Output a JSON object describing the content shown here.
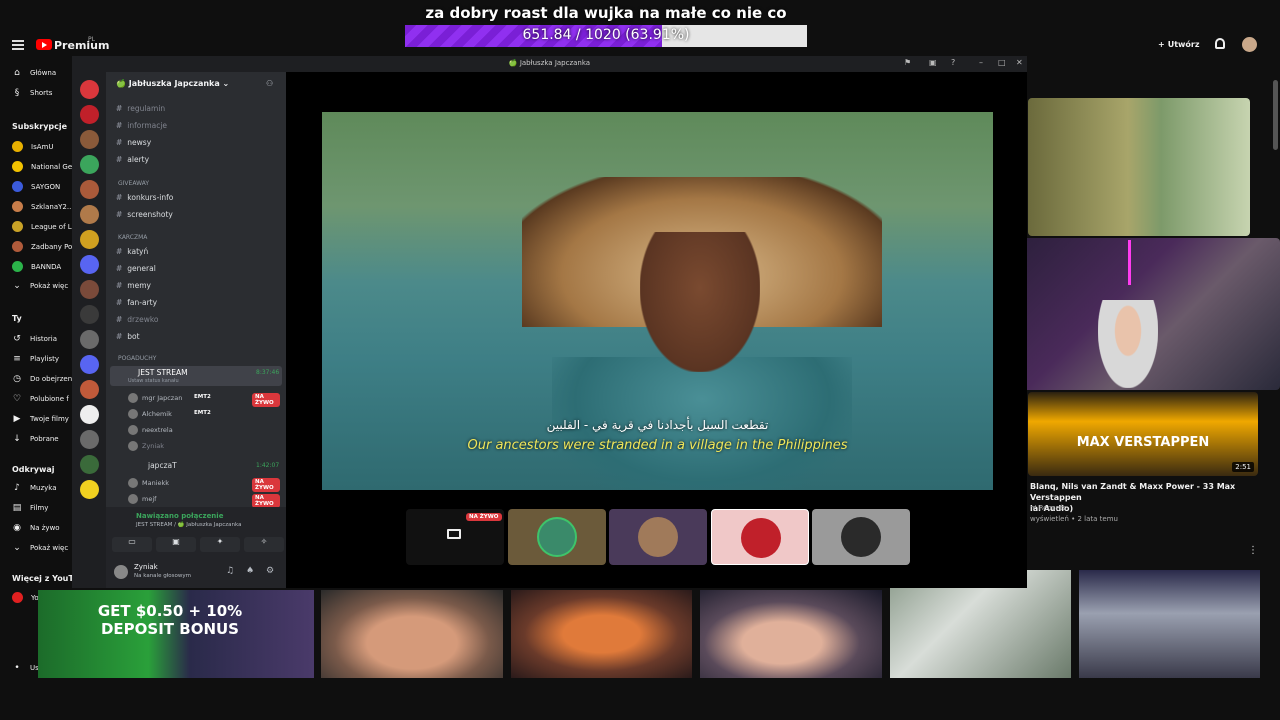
{
  "overlay": {
    "title": "za dobry roast dla wujka na małe co nie co",
    "progress_text": "651.84 / 1020 (63.91%)",
    "progress_fraction": 0.6391,
    "color": "#8a2be2"
  },
  "youtube": {
    "brand": "Premium",
    "region": "PL",
    "create_label": "Utwórz",
    "sidebar_top": [
      {
        "label": "Główna",
        "icon": "home-icon"
      },
      {
        "label": "Shorts",
        "icon": "shorts-icon"
      }
    ],
    "subs_title": "Subskrypcje",
    "subs": [
      {
        "label": "IsAmU",
        "color": "#e8b000"
      },
      {
        "label": "National Ge",
        "color": "#f2c200"
      },
      {
        "label": "SAYGON",
        "color": "#3b5bdb"
      },
      {
        "label": "SzklanaY2...",
        "color": "#c77d4a"
      },
      {
        "label": "League of L",
        "color": "#c9a227"
      },
      {
        "label": "Zadbany Po",
        "color": "#b05b3b"
      },
      {
        "label": "BANNDA",
        "color": "#2bb34a"
      },
      {
        "label": "Pokaż więc",
        "icon": "chevron-down-icon"
      }
    ],
    "you_title": "Ty",
    "you": [
      {
        "label": "Historia",
        "icon": "history-icon"
      },
      {
        "label": "Playlisty",
        "icon": "playlist-icon"
      },
      {
        "label": "Do obejrzen",
        "icon": "clock-icon"
      },
      {
        "label": "Polubione f",
        "icon": "like-icon"
      },
      {
        "label": "Twoje filmy",
        "icon": "video-icon"
      },
      {
        "label": "Pobrane",
        "icon": "download-icon"
      }
    ],
    "explore_title": "Odkrywaj",
    "explore": [
      {
        "label": "Muzyka",
        "icon": "music-icon"
      },
      {
        "label": "Filmy",
        "icon": "film-icon"
      },
      {
        "label": "Na żywo",
        "icon": "live-icon"
      },
      {
        "label": "Pokaż więc",
        "icon": "chevron-down-icon"
      }
    ],
    "more_title": "Więcej z YouTub",
    "more": [
      {
        "label": "YouTube Studio"
      }
    ],
    "settings": "Ustawienia",
    "video_title": "Blanq, Nils van Zandt & Maxx Power - 33 Max Verstappen",
    "video_title2": "ial Audio)",
    "video_channel": "n' Records",
    "video_meta": "wyświetleń • 2 lata temu",
    "video_duration": "2:51",
    "thumb_text": "MAX VERSTAPPEN",
    "ad_text": "GET $0.50 + 10% DEPOSIT BONUS"
  },
  "discord": {
    "window_title": "🍏 Jabłuszka Japczanka",
    "server_name": "Jabłuszka Japczanka",
    "channels": [
      {
        "name": "regulamin",
        "dim": true
      },
      {
        "name": "informacje",
        "dim": true
      },
      {
        "name": "newsy"
      },
      {
        "name": "alerty"
      }
    ],
    "cat_giveaway": "GIVEAWAY",
    "giveaway": [
      {
        "name": "konkurs-info"
      },
      {
        "name": "screenshoty"
      }
    ],
    "cat_karczma": "KARCZMA",
    "karczma": [
      {
        "name": "katyń"
      },
      {
        "name": "general"
      },
      {
        "name": "memy"
      },
      {
        "name": "fan-arty"
      },
      {
        "name": "drzewko",
        "dim": true
      },
      {
        "name": "bot"
      }
    ],
    "cat_pogaduchy": "POGADUCHY",
    "voice1": {
      "name": "JEST STREAM",
      "time": "8:37:46",
      "status": "Ustaw status kanału"
    },
    "voice1_users": [
      {
        "name": "mgr Japczan",
        "tag": "EMT2",
        "live": "NA ŻYWO"
      },
      {
        "name": "Alchemik",
        "tag": "EMT2"
      },
      {
        "name": "neextrela"
      },
      {
        "name": "Zyniak",
        "dim": true
      }
    ],
    "voice2": {
      "name": "japczaT",
      "time": "1:42:07"
    },
    "voice2_users": [
      {
        "name": "Maniekk",
        "live": "NA ŻYWO"
      },
      {
        "name": "mejf",
        "live": "NA ŻYWO"
      }
    ],
    "conn_status": "Nawiązano połączenie",
    "conn_detail": "JEST STREAM / 🍏 Jabłuszka Japczanka",
    "user_name": "Zyniak",
    "user_status": "Na kanale głosowym",
    "live_badge": "NA ŻYWO"
  },
  "video": {
    "sub_ar": "تقطعت السبل بأجدادنا في قرية في - الفلبين",
    "sub_en": "Our ancestors were stranded in a village in the Philippines"
  }
}
